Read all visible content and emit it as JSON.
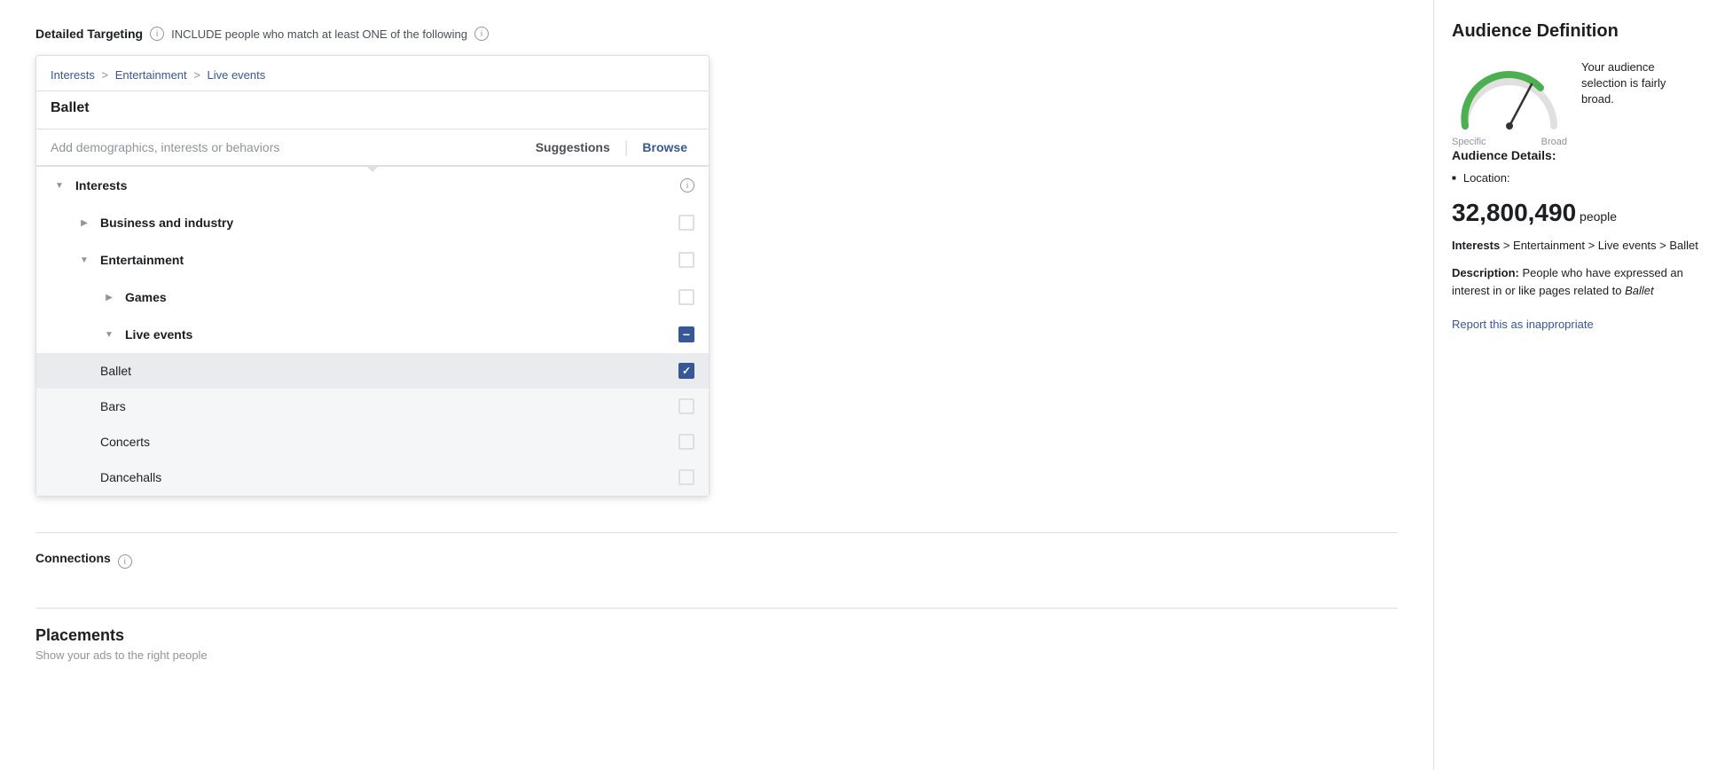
{
  "page": {
    "targeting_title": "Detailed Targeting",
    "include_text": "INCLUDE people who match at least ONE of the following",
    "connections_title": "Connections",
    "placements_title": "Placements",
    "placements_subtitle": "Show your ads to the right people"
  },
  "breadcrumb": {
    "interests": "Interests",
    "entertainment": "Entertainment",
    "live_events": "Live events",
    "sep1": ">",
    "sep2": ">"
  },
  "current_item": {
    "title": "Ballet"
  },
  "search": {
    "placeholder": "Add demographics, interests or behaviors"
  },
  "tabs": {
    "suggestions": "Suggestions",
    "browse": "Browse"
  },
  "categories": [
    {
      "id": "interests",
      "label": "Interests",
      "expanded": true,
      "has_info": true,
      "children": [
        {
          "id": "business_industry",
          "label": "Business and industry",
          "expanded": false,
          "children": []
        },
        {
          "id": "entertainment",
          "label": "Entertainment",
          "expanded": true,
          "children": [
            {
              "id": "games",
              "label": "Games",
              "expanded": false,
              "children": []
            },
            {
              "id": "live_events",
              "label": "Live events",
              "expanded": true,
              "indeterminate": true,
              "children": [
                {
                  "id": "ballet",
                  "label": "Ballet",
                  "checked": true
                },
                {
                  "id": "bars",
                  "label": "Bars",
                  "checked": false
                },
                {
                  "id": "concerts",
                  "label": "Concerts",
                  "checked": false
                },
                {
                  "id": "dancehalls",
                  "label": "Dancehalls",
                  "checked": false
                }
              ]
            }
          ]
        }
      ]
    }
  ],
  "audience_definition": {
    "title": "Audience Definition",
    "gauge_text": "Your audience selection is fairly broad.",
    "label_specific": "Specific",
    "label_broad": "Broad",
    "details_title": "Audience Details:",
    "location_label": "Location:",
    "people_count": "32,800,490",
    "people_suffix": "people",
    "path_label": "Interests",
    "path_text": "> Entertainment > Live events > Ballet",
    "description_label": "Description:",
    "description_text": "People who have expressed an interest in or like pages related to",
    "description_italic": "Ballet",
    "report_link": "Report this as inappropriate"
  },
  "icons": {
    "info": "i",
    "expand": "▶",
    "collapse": "▼",
    "check": "✓",
    "minus": "−"
  }
}
